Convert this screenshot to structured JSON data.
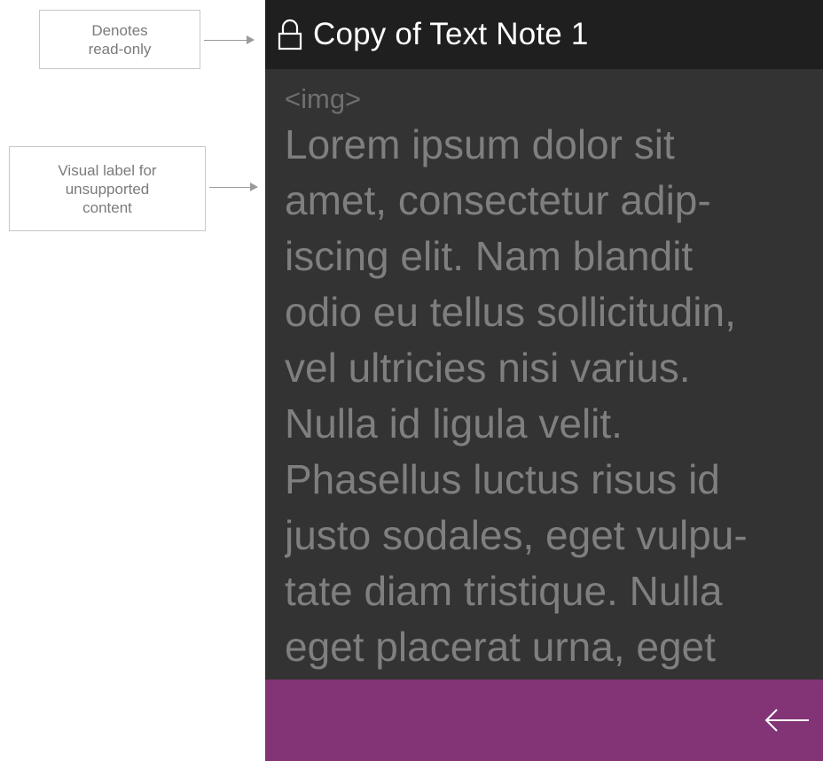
{
  "annotations": {
    "readonly_label": "Denotes\nread-only",
    "unsupported_label": "Visual label for\nunsupported\ncontent"
  },
  "titlebar": {
    "icon": "lock-icon",
    "title": "Copy of Text Note 1"
  },
  "note": {
    "unsupported_placeholder": "<img>",
    "lines": [
      "Lorem ipsum dolor sit",
      "amet, consectetur adip-",
      "iscing elit.  Nam blandit",
      "odio eu tellus sollicitudin,",
      "vel ultricies nisi varius.",
      "Nulla id ligula velit.",
      "Phasellus luctus risus id",
      "justo sodales, eget vulpu-",
      "tate diam tristique. Nulla",
      "eget placerat urna, eget"
    ]
  },
  "appbar": {
    "icon": "back-arrow-icon"
  },
  "colors": {
    "titlebar_bg": "#201f1f",
    "content_bg": "#323332",
    "body_text": "#7e7f7e",
    "appbar_bg": "#823476"
  }
}
